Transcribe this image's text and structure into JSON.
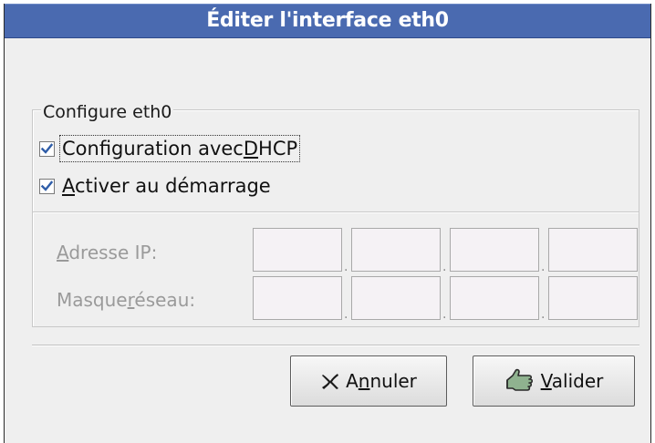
{
  "window": {
    "title": "Éditer l'interface eth0"
  },
  "frame": {
    "label": "Configure eth0"
  },
  "options": {
    "dhcp": {
      "label_pre": "Configuration avec",
      "label_mn": "D",
      "label_post": "HCP",
      "checked": true
    },
    "onboot": {
      "label_mn": "A",
      "label_post": "ctiver au démarrage",
      "checked": true
    }
  },
  "fields": {
    "ip": {
      "label_mn": "A",
      "label_post": "dresse IP:",
      "values": [
        "",
        "",
        "",
        ""
      ]
    },
    "netmask": {
      "label_pre": "Masque",
      "label_mn": "r",
      "label_post": "éseau:",
      "values": [
        "",
        "",
        "",
        ""
      ]
    },
    "separator": "."
  },
  "buttons": {
    "cancel": {
      "pre": "A",
      "mn": "n",
      "post": "nuler",
      "icon": "cancel-x-icon"
    },
    "ok": {
      "mn": "V",
      "post": "alider",
      "icon": "ok-hand-icon"
    }
  },
  "colors": {
    "titlebar": "#4a6ab0",
    "background": "#efefef",
    "check_mark": "#2f5da8"
  }
}
